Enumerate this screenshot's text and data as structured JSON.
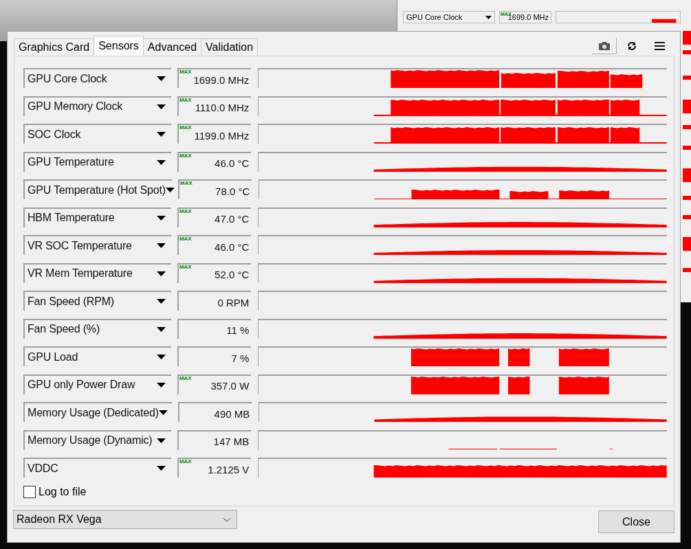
{
  "background_window": {
    "row": {
      "label": "GPU Core Clock",
      "badge": "MAX",
      "value": "1699.0 MHz"
    }
  },
  "window": {
    "tabs": [
      {
        "label": "Graphics Card",
        "selected": false
      },
      {
        "label": "Sensors",
        "selected": true
      },
      {
        "label": "Advanced",
        "selected": false
      },
      {
        "label": "Validation",
        "selected": false
      }
    ],
    "sensors": [
      {
        "label": "GPU Core Clock",
        "badge": "MAX",
        "value": "1699.0 MHz",
        "kind": "blocks"
      },
      {
        "label": "GPU Memory Clock",
        "badge": "MAX",
        "value": "1110.0 MHz",
        "kind": "blocks_floor"
      },
      {
        "label": "SOC Clock",
        "badge": "MAX",
        "value": "1199.0 MHz",
        "kind": "blocks_floor"
      },
      {
        "label": "GPU Temperature",
        "badge": "MAX",
        "value": "46.0 °C",
        "kind": "low"
      },
      {
        "label": "GPU Temperature (Hot Spot)",
        "badge": "MAX",
        "value": "78.0 °C",
        "kind": "mid"
      },
      {
        "label": "HBM Temperature",
        "badge": "MAX",
        "value": "47.0 °C",
        "kind": "low"
      },
      {
        "label": "VR SOC Temperature",
        "badge": "MAX",
        "value": "46.0 °C",
        "kind": "low"
      },
      {
        "label": "VR Mem Temperature",
        "badge": "MAX",
        "value": "52.0 °C",
        "kind": "low"
      },
      {
        "label": "Fan Speed (RPM)",
        "value": "0 RPM",
        "kind": "none"
      },
      {
        "label": "Fan Speed (%)",
        "value": "11 %",
        "kind": "low"
      },
      {
        "label": "GPU Load",
        "value": "7 %",
        "kind": "load"
      },
      {
        "label": "GPU only Power Draw",
        "badge": "MAX",
        "value": "357.0 W",
        "kind": "load"
      },
      {
        "label": "Memory Usage (Dedicated)",
        "value": "490 MB",
        "kind": "low"
      },
      {
        "label": "Memory Usage (Dynamic)",
        "value": "147 MB",
        "kind": "line"
      },
      {
        "label": "VDDC",
        "badge": "MAX",
        "value": "1.2125 V",
        "kind": "high"
      }
    ],
    "log_to_file": {
      "label": "Log to file",
      "checked": false
    },
    "device": {
      "value": "Radeon RX Vega"
    },
    "close_button": "Close"
  }
}
